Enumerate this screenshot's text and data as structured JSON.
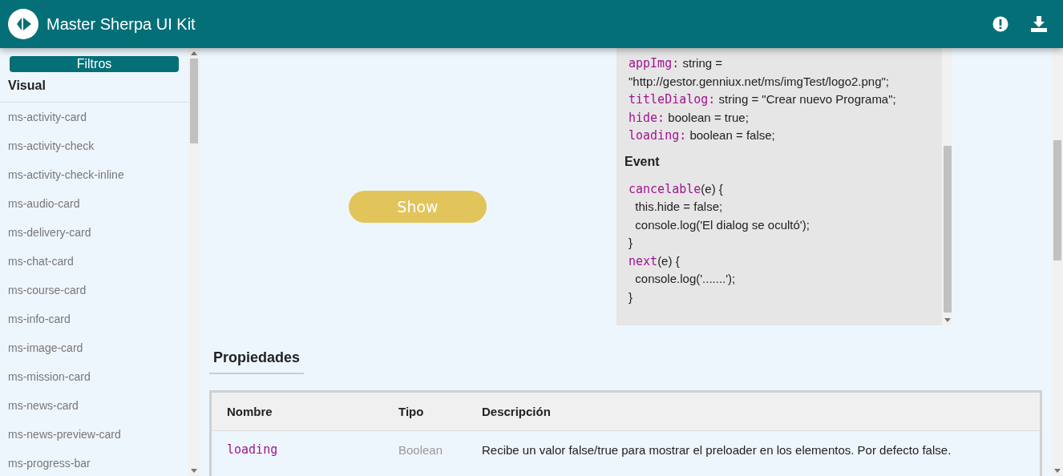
{
  "header": {
    "title": "Master Sherpa UI Kit"
  },
  "sidebar": {
    "filter_button": "Filtros",
    "section": "Visual",
    "items": [
      {
        "label": "ms-activity-card"
      },
      {
        "label": "ms-activity-check"
      },
      {
        "label": "ms-activity-check-inline"
      },
      {
        "label": "ms-audio-card"
      },
      {
        "label": "ms-delivery-card"
      },
      {
        "label": "ms-chat-card"
      },
      {
        "label": "ms-course-card"
      },
      {
        "label": "ms-info-card"
      },
      {
        "label": "ms-image-card"
      },
      {
        "label": "ms-mission-card"
      },
      {
        "label": "ms-news-card"
      },
      {
        "label": "ms-news-preview-card"
      },
      {
        "label": "ms-progress-bar"
      }
    ]
  },
  "preview": {
    "button": "Show"
  },
  "code": {
    "properties": [
      {
        "key": "appImg:",
        "text": "string ="
      },
      {
        "text": "\"http://gestor.genniux.net/ms/imgTest/logo2.png\";"
      },
      {
        "key": "titleDialog:",
        "text": "string = \"Crear nuevo Programa\";"
      },
      {
        "key": "hide:",
        "text": "boolean = true;"
      },
      {
        "key": "loading:",
        "text": "boolean = false;"
      }
    ],
    "event_heading": "Event",
    "events": [
      {
        "key": "cancelable",
        "text": "(e) {"
      },
      {
        "text": "  this.hide = false;"
      },
      {
        "text": "  console.log('El dialog se ocultó');"
      },
      {
        "text": "}"
      },
      {
        "key": "next",
        "text": "(e) {"
      },
      {
        "text": "  console.log('.......');"
      },
      {
        "text": "}"
      }
    ]
  },
  "properties": {
    "heading": "Propiedades",
    "columns": [
      "Nombre",
      "Tipo",
      "Descripción"
    ],
    "rows": [
      {
        "name": "loading",
        "type": "Boolean",
        "description": "Recibe un valor false/true para mostrar el preloader en los elementos. Por defecto false."
      }
    ]
  }
}
